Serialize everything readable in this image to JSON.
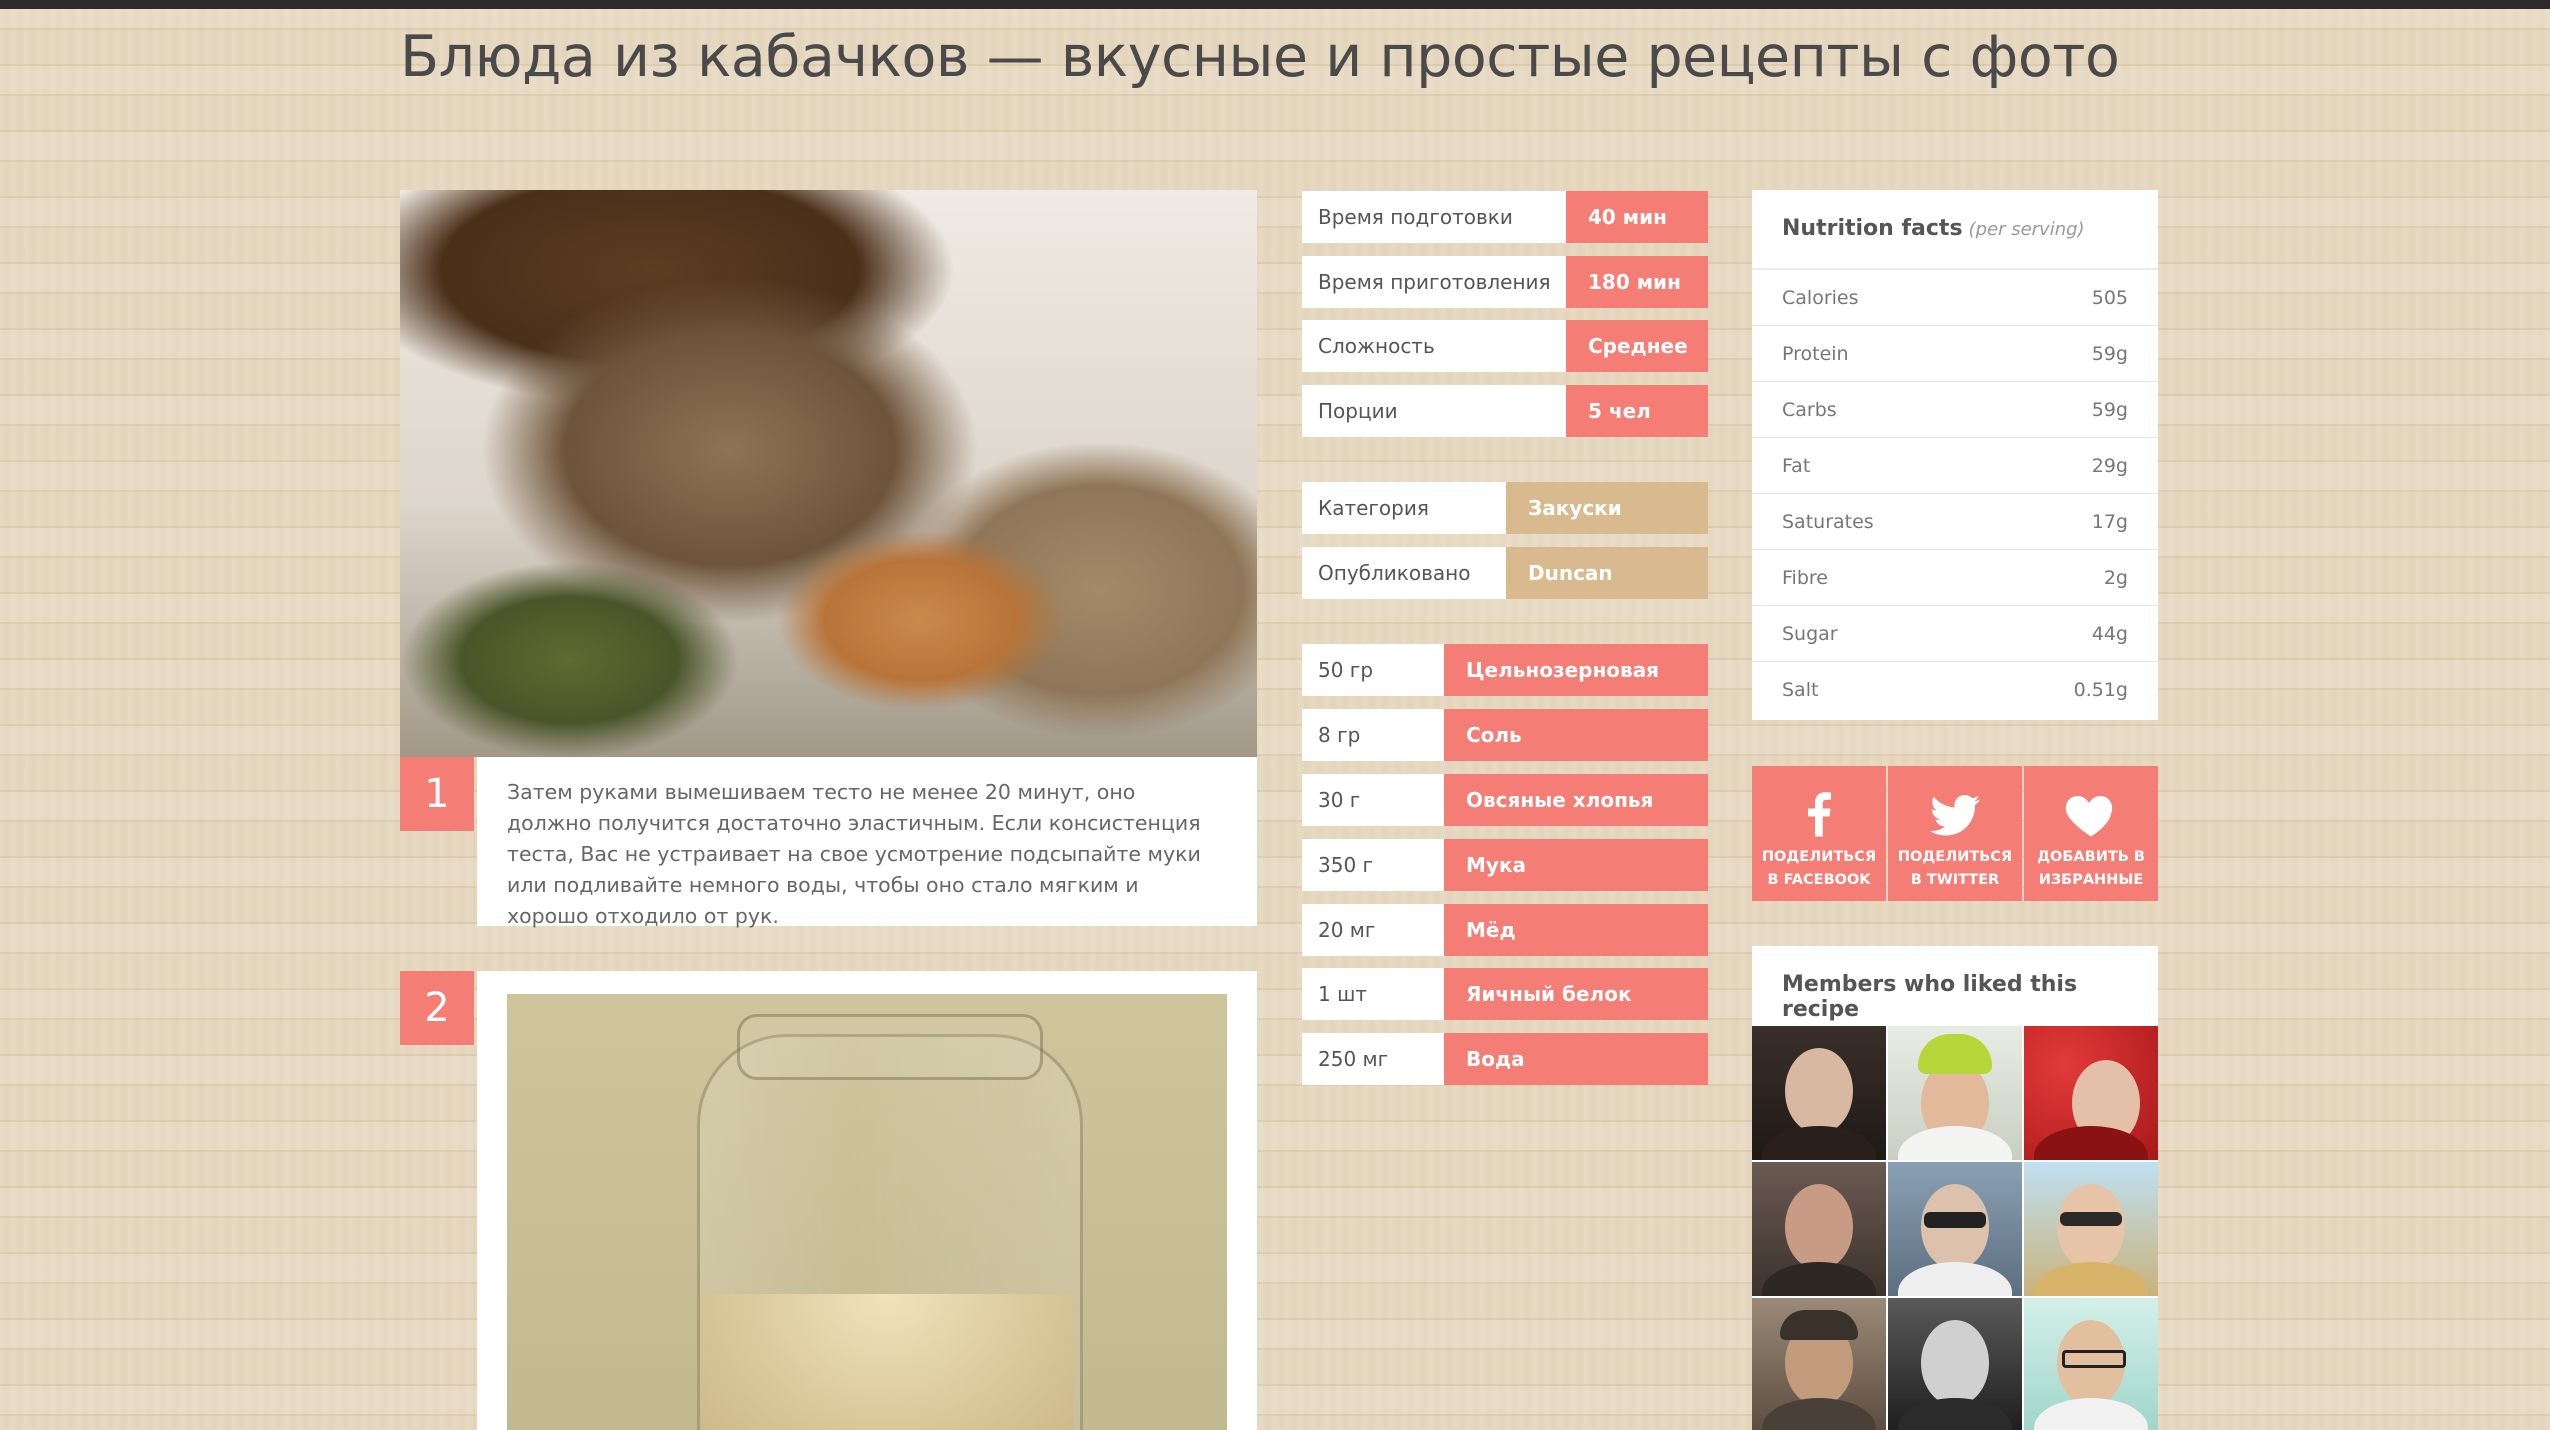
{
  "page": {
    "title": "Блюда из кабачков — вкусные и простые рецепты с фото"
  },
  "main_image": {
    "alt": "Хлеб с семенами и злаками"
  },
  "steps": [
    {
      "number": "1",
      "text": "Затем руками вымешиваем тесто не менее 20 минут, оно должно получится достаточно эластичным. Если консистенция теста, Вас не устраивает на свое усмотрение подсыпайте муки или подливайте немного воды, чтобы оно стало мягким и хорошо отходило от рук."
    },
    {
      "number": "2",
      "image_alt": "Стеклянная банка с закваской"
    }
  ],
  "recipe_info": [
    {
      "label": "Время подготовки",
      "value": "40 мин"
    },
    {
      "label": "Время приготовления",
      "value": "180 мин"
    },
    {
      "label": "Сложность",
      "value": "Среднее"
    },
    {
      "label": "Порции",
      "value": "5 чел"
    }
  ],
  "meta": [
    {
      "label": "Категория",
      "value": "Закуски"
    },
    {
      "label": "Опубликовано",
      "value": "Duncan"
    }
  ],
  "ingredients": [
    {
      "amount": "50 гр",
      "name": "Цельнозерновая"
    },
    {
      "amount": "8 гр",
      "name": "Соль"
    },
    {
      "amount": "30 г",
      "name": "Овсяные хлопья"
    },
    {
      "amount": "350 г",
      "name": "Мука"
    },
    {
      "amount": "20 мг",
      "name": "Мёд"
    },
    {
      "amount": "1 шт",
      "name": "Яичный белок"
    },
    {
      "amount": "250 мг",
      "name": "Вода"
    }
  ],
  "nutrition": {
    "title": "Nutrition facts",
    "subtitle": "(per serving)",
    "rows": [
      {
        "label": "Calories",
        "value": "505"
      },
      {
        "label": "Protein",
        "value": "59g"
      },
      {
        "label": "Carbs",
        "value": "59g"
      },
      {
        "label": "Fat",
        "value": "29g"
      },
      {
        "label": "Saturates",
        "value": "17g"
      },
      {
        "label": "Fibre",
        "value": "2g"
      },
      {
        "label": "Sugar",
        "value": "44g"
      },
      {
        "label": "Salt",
        "value": "0.51g"
      }
    ]
  },
  "share": {
    "facebook": {
      "line1": "Поделиться",
      "line2": "в Facebook",
      "icon": "facebook-icon"
    },
    "twitter": {
      "line1": "Поделиться",
      "line2": "в Twitter",
      "icon": "twitter-icon"
    },
    "favorite": {
      "line1": "Добавить в",
      "line2": "избранные",
      "icon": "heart-icon"
    }
  },
  "members": {
    "title": "Members who liked this recipe",
    "avatars": [
      {
        "name": "member-1"
      },
      {
        "name": "member-2"
      },
      {
        "name": "member-3"
      },
      {
        "name": "member-4"
      },
      {
        "name": "member-5"
      },
      {
        "name": "member-6"
      },
      {
        "name": "member-7"
      },
      {
        "name": "member-8"
      },
      {
        "name": "member-9"
      }
    ]
  },
  "colors": {
    "accent": "#f47e76",
    "tan": "#d9b98e",
    "topbar": "#2c2a2c",
    "card": "#ffffff"
  }
}
